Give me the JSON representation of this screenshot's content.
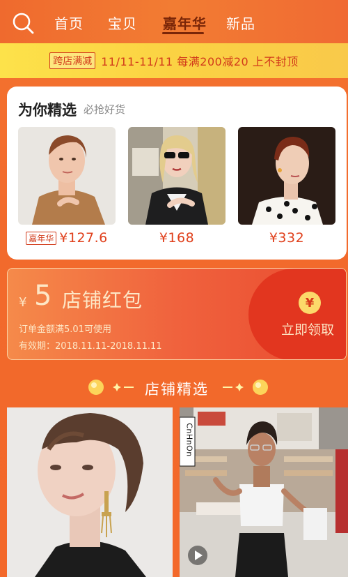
{
  "nav": {
    "tabs": [
      {
        "label": "首页",
        "active": false
      },
      {
        "label": "宝贝",
        "active": false
      },
      {
        "label": "嘉年华",
        "active": true
      },
      {
        "label": "新品",
        "active": false
      }
    ]
  },
  "promo": {
    "badge": "跨店满减",
    "text": "11/11-11/11  每满200减20 上不封顶"
  },
  "picks": {
    "title": "为你精选",
    "subtitle": "必抢好货",
    "items": [
      {
        "badge": "嘉年华",
        "price": "¥127.6"
      },
      {
        "badge": "",
        "price": "¥168"
      },
      {
        "badge": "",
        "price": "¥332"
      }
    ]
  },
  "packet": {
    "currency": "¥",
    "amount": "5",
    "name": "店铺红包",
    "condition": "订单金额满5.01可使用",
    "validity": "有效期：2018.11.11-2018.11.11",
    "coin_symbol": "¥",
    "claim_label": "立即领取"
  },
  "section": {
    "title": "店铺精选"
  },
  "products": [
    {
      "sign": ""
    },
    {
      "sign": "CnHnOn"
    }
  ],
  "colors": {
    "accent": "#f26a2c",
    "promo_yellow": "#fbd243",
    "price_red": "#e0401c",
    "active_tab": "#7a2608"
  }
}
